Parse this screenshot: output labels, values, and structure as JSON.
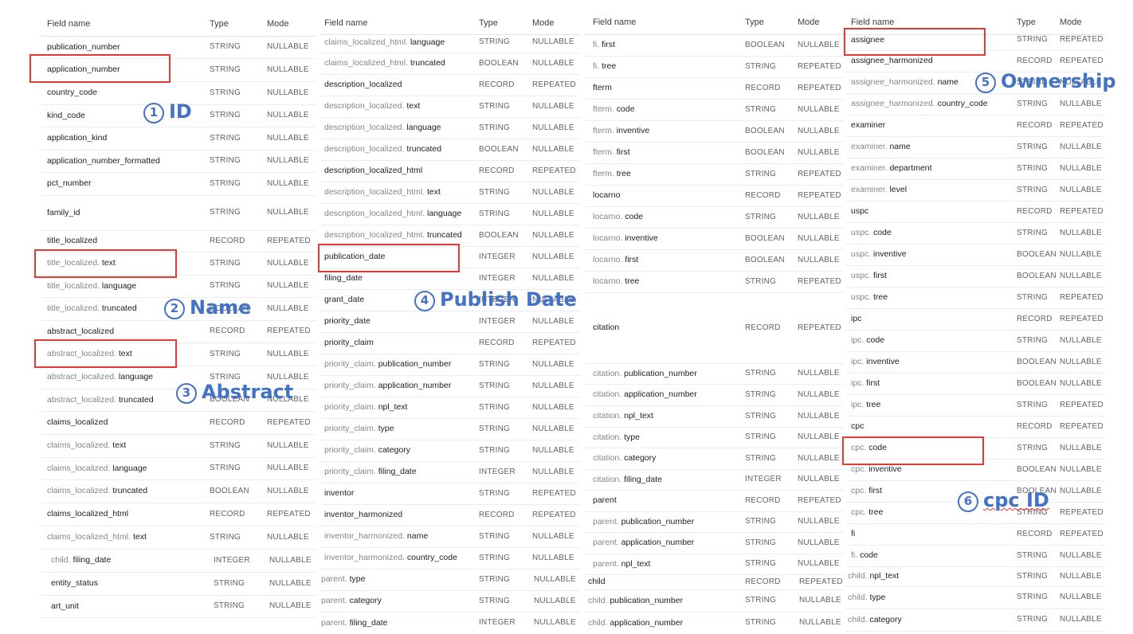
{
  "header": {
    "field": "Field name",
    "type": "Type",
    "mode": "Mode"
  },
  "panels": [
    {
      "rows": [
        [
          "",
          "publication_number",
          "STRING",
          "NULLABLE"
        ],
        [
          "",
          "application_number",
          "STRING",
          "NULLABLE"
        ],
        [
          "",
          "country_code",
          "STRING",
          "NULLABLE"
        ],
        [
          "",
          "kind_code",
          "STRING",
          "NULLABLE"
        ],
        [
          "",
          "application_kind",
          "STRING",
          "NULLABLE"
        ],
        [
          "",
          "application_number_formatted",
          "STRING",
          "NULLABLE"
        ],
        [
          "",
          "pct_number",
          "STRING",
          "NULLABLE"
        ],
        [
          "",
          "family_id",
          "STRING",
          "NULLABLE"
        ],
        [
          "",
          "title_localized",
          "RECORD",
          "REPEATED"
        ],
        [
          "title_localized. ",
          "text",
          "STRING",
          "NULLABLE"
        ],
        [
          "title_localized. ",
          "language",
          "STRING",
          "NULLABLE"
        ],
        [
          "title_localized. ",
          "truncated",
          "BOOLEAN",
          "NULLABLE"
        ],
        [
          "",
          "abstract_localized",
          "RECORD",
          "REPEATED"
        ],
        [
          "abstract_localized. ",
          "text",
          "STRING",
          "NULLABLE"
        ],
        [
          "abstract_localized. ",
          "language",
          "STRING",
          "NULLABLE"
        ],
        [
          "abstract_localized. ",
          "truncated",
          "BOOLEAN",
          "NULLABLE"
        ],
        [
          "",
          "claims_localized",
          "RECORD",
          "REPEATED"
        ],
        [
          "claims_localized. ",
          "text",
          "STRING",
          "NULLABLE"
        ],
        [
          "claims_localized. ",
          "language",
          "STRING",
          "NULLABLE"
        ],
        [
          "claims_localized. ",
          "truncated",
          "BOOLEAN",
          "NULLABLE"
        ],
        [
          "",
          "claims_localized_html",
          "RECORD",
          "REPEATED"
        ],
        [
          "claims_localized_html. ",
          "text",
          "STRING",
          "NULLABLE"
        ],
        [
          "child. ",
          "filing_date",
          "INTEGER",
          "NULLABLE"
        ],
        [
          "",
          "entity_status",
          "STRING",
          "NULLABLE"
        ],
        [
          "",
          "art_unit",
          "STRING",
          "NULLABLE"
        ]
      ]
    },
    {
      "rows": [
        [
          "claims_localized_html. ",
          "language",
          "STRING",
          "NULLABLE"
        ],
        [
          "claims_localized_html. ",
          "truncated",
          "BOOLEAN",
          "NULLABLE"
        ],
        [
          "",
          "description_localized",
          "RECORD",
          "REPEATED"
        ],
        [
          "description_localized. ",
          "text",
          "STRING",
          "NULLABLE"
        ],
        [
          "description_localized. ",
          "language",
          "STRING",
          "NULLABLE"
        ],
        [
          "description_localized. ",
          "truncated",
          "BOOLEAN",
          "NULLABLE"
        ],
        [
          "",
          "description_localized_html",
          "RECORD",
          "REPEATED"
        ],
        [
          "description_localized_html. ",
          "text",
          "STRING",
          "NULLABLE"
        ],
        [
          "description_localized_html. ",
          "language",
          "STRING",
          "NULLABLE"
        ],
        [
          "description_localized_html. ",
          "truncated",
          "BOOLEAN",
          "NULLABLE"
        ],
        [
          "",
          "publication_date",
          "INTEGER",
          "NULLABLE"
        ],
        [
          "",
          "filing_date",
          "INTEGER",
          "NULLABLE"
        ],
        [
          "",
          "grant_date",
          "INTEGER",
          "NULLABLE"
        ],
        [
          "",
          "priority_date",
          "INTEGER",
          "NULLABLE"
        ],
        [
          "",
          "priority_claim",
          "RECORD",
          "REPEATED"
        ],
        [
          "priority_claim. ",
          "publication_number",
          "STRING",
          "NULLABLE"
        ],
        [
          "priority_claim. ",
          "application_number",
          "STRING",
          "NULLABLE"
        ],
        [
          "priority_claim. ",
          "npl_text",
          "STRING",
          "NULLABLE"
        ],
        [
          "priority_claim. ",
          "type",
          "STRING",
          "NULLABLE"
        ],
        [
          "priority_claim. ",
          "category",
          "STRING",
          "NULLABLE"
        ],
        [
          "priority_claim. ",
          "filing_date",
          "INTEGER",
          "NULLABLE"
        ],
        [
          "",
          "inventor",
          "STRING",
          "REPEATED"
        ],
        [
          "",
          "inventor_harmonized",
          "RECORD",
          "REPEATED"
        ],
        [
          "inventor_harmonized. ",
          "name",
          "STRING",
          "NULLABLE"
        ],
        [
          "inventor_harmonized. ",
          "country_code",
          "STRING",
          "NULLABLE"
        ],
        [
          "parent. ",
          "type",
          "STRING",
          "NULLABLE"
        ],
        [
          "parent. ",
          "category",
          "STRING",
          "NULLABLE"
        ],
        [
          "parent. ",
          "filing_date",
          "INTEGER",
          "NULLABLE"
        ]
      ]
    },
    {
      "rows": [
        [
          "fi. ",
          "first",
          "BOOLEAN",
          "NULLABLE"
        ],
        [
          "fi. ",
          "tree",
          "STRING",
          "REPEATED"
        ],
        [
          "",
          "fterm",
          "RECORD",
          "REPEATED"
        ],
        [
          "fterm. ",
          "code",
          "STRING",
          "NULLABLE"
        ],
        [
          "fterm. ",
          "inventive",
          "BOOLEAN",
          "NULLABLE"
        ],
        [
          "fterm. ",
          "first",
          "BOOLEAN",
          "NULLABLE"
        ],
        [
          "fterm. ",
          "tree",
          "STRING",
          "REPEATED"
        ],
        [
          "",
          "locarno",
          "RECORD",
          "REPEATED"
        ],
        [
          "locarno. ",
          "code",
          "STRING",
          "NULLABLE"
        ],
        [
          "locarno. ",
          "inventive",
          "BOOLEAN",
          "NULLABLE"
        ],
        [
          "locarno. ",
          "first",
          "BOOLEAN",
          "NULLABLE"
        ],
        [
          "locarno. ",
          "tree",
          "STRING",
          "REPEATED"
        ],
        [
          "",
          "citation",
          "RECORD",
          "REPEATED"
        ],
        [
          "citation. ",
          "publication_number",
          "STRING",
          "NULLABLE"
        ],
        [
          "citation. ",
          "application_number",
          "STRING",
          "NULLABLE"
        ],
        [
          "citation. ",
          "npl_text",
          "STRING",
          "NULLABLE"
        ],
        [
          "citation. ",
          "type",
          "STRING",
          "NULLABLE"
        ],
        [
          "citation. ",
          "category",
          "STRING",
          "NULLABLE"
        ],
        [
          "citation. ",
          "filing_date",
          "INTEGER",
          "NULLABLE"
        ],
        [
          "",
          "parent",
          "RECORD",
          "REPEATED"
        ],
        [
          "parent. ",
          "publication_number",
          "STRING",
          "NULLABLE"
        ],
        [
          "parent. ",
          "application_number",
          "STRING",
          "NULLABLE"
        ],
        [
          "parent. ",
          "npl_text",
          "STRING",
          "NULLABLE"
        ],
        [
          "",
          "child",
          "RECORD",
          "REPEATED"
        ],
        [
          "child. ",
          "publication_number",
          "STRING",
          "NULLABLE"
        ],
        [
          "child. ",
          "application_number",
          "STRING",
          "NULLABLE"
        ]
      ]
    },
    {
      "rows": [
        [
          "",
          "assignee",
          "STRING",
          "REPEATED"
        ],
        [
          "",
          "assignee_harmonized",
          "RECORD",
          "REPEATED"
        ],
        [
          "assignee_harmonized. ",
          "name",
          "STRING",
          "NULLABLE"
        ],
        [
          "assignee_harmonized. ",
          "country_code",
          "STRING",
          "NULLABLE"
        ],
        [
          "",
          "examiner",
          "RECORD",
          "REPEATED"
        ],
        [
          "examiner. ",
          "name",
          "STRING",
          "NULLABLE"
        ],
        [
          "examiner. ",
          "department",
          "STRING",
          "NULLABLE"
        ],
        [
          "examiner. ",
          "level",
          "STRING",
          "NULLABLE"
        ],
        [
          "",
          "uspc",
          "RECORD",
          "REPEATED"
        ],
        [
          "uspc. ",
          "code",
          "STRING",
          "NULLABLE"
        ],
        [
          "uspc. ",
          "inventive",
          "BOOLEAN",
          "NULLABLE"
        ],
        [
          "uspc. ",
          "first",
          "BOOLEAN",
          "NULLABLE"
        ],
        [
          "uspc. ",
          "tree",
          "STRING",
          "REPEATED"
        ],
        [
          "",
          "ipc",
          "RECORD",
          "REPEATED"
        ],
        [
          "ipc. ",
          "code",
          "STRING",
          "NULLABLE"
        ],
        [
          "ipc. ",
          "inventive",
          "BOOLEAN",
          "NULLABLE"
        ],
        [
          "ipc. ",
          "first",
          "BOOLEAN",
          "NULLABLE"
        ],
        [
          "ipc. ",
          "tree",
          "STRING",
          "REPEATED"
        ],
        [
          "",
          "cpc",
          "RECORD",
          "REPEATED"
        ],
        [
          "cpc. ",
          "code",
          "STRING",
          "NULLABLE"
        ],
        [
          "cpc. ",
          "inventive",
          "BOOLEAN",
          "NULLABLE"
        ],
        [
          "cpc. ",
          "first",
          "BOOLEAN",
          "NULLABLE"
        ],
        [
          "cpc. ",
          "tree",
          "STRING",
          "REPEATED"
        ],
        [
          "",
          "fi",
          "RECORD",
          "REPEATED"
        ],
        [
          "fi. ",
          "code",
          "STRING",
          "NULLABLE"
        ],
        [
          "child. ",
          "npl_text",
          "STRING",
          "NULLABLE"
        ],
        [
          "child. ",
          "type",
          "STRING",
          "NULLABLE"
        ],
        [
          "child. ",
          "category",
          "STRING",
          "NULLABLE"
        ]
      ]
    }
  ],
  "annotations": [
    {
      "num": "1",
      "label": "ID"
    },
    {
      "num": "2",
      "label": "Name"
    },
    {
      "num": "3",
      "label": "Abstract"
    },
    {
      "num": "4",
      "label": "Publish Date"
    },
    {
      "num": "5",
      "label": "Ownership"
    },
    {
      "num": "6",
      "label": "cpc ID"
    }
  ],
  "colors": {
    "highlight_box": "#e53935",
    "annotation": "#4472c4",
    "grid_line": "#ececec"
  }
}
